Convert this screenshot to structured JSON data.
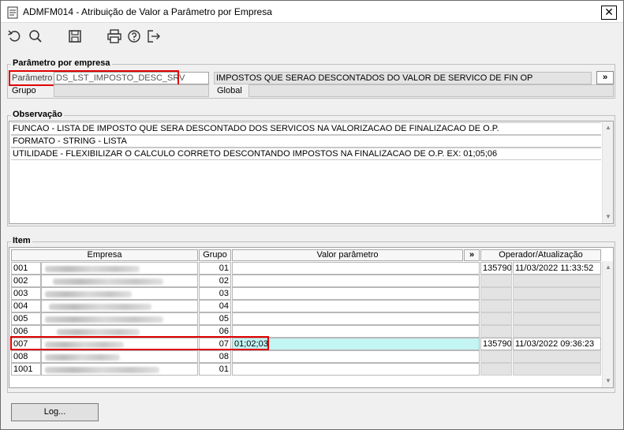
{
  "window": {
    "title": "ADMFM014 - Atribuição de Valor a Parâmetro por Empresa",
    "close_label": "✕"
  },
  "toolbar": {
    "icons": [
      "undo-icon",
      "search-icon",
      "save-icon",
      "print-icon",
      "help-icon",
      "exit-icon"
    ]
  },
  "parametro_empresa": {
    "legend": "Parâmetro por empresa",
    "parametro_label": "Parâmetro",
    "parametro_value": "DS_LST_IMPOSTO_DESC_SRV",
    "descricao_value": "IMPOSTOS QUE SERAO DESCONTADOS DO VALOR DE SERVICO DE FIN OP",
    "expand_label": "»",
    "grupo_label": "Grupo",
    "grupo_value": "",
    "global_label": "Global",
    "global_value": ""
  },
  "observacao": {
    "legend": "Observação",
    "lines": [
      "FUNCAO - LISTA DE IMPOSTO QUE SERA DESCONTADO DOS SERVICOS NA VALORIZACAO DE FINALIZACAO DE O.P.",
      "FORMATO - STRING - LISTA",
      "UTILIDADE - FLEXIBILIZAR O CALCULO CORRETO DESCONTANDO IMPOSTOS NA FINALIZACAO DE O.P. EX: 01;05;06"
    ]
  },
  "item": {
    "legend": "Item",
    "columns": {
      "empresa": "Empresa",
      "grupo": "Grupo",
      "valor": "Valor parâmetro",
      "expand": "»",
      "operador": "Operador/Atualização"
    },
    "rows": [
      {
        "code": "001",
        "grupo": "01",
        "valor": "",
        "operador": "135790",
        "data": "11/03/2022 11:33:52"
      },
      {
        "code": "002",
        "grupo": "02",
        "valor": "",
        "operador": "",
        "data": ""
      },
      {
        "code": "003",
        "grupo": "03",
        "valor": "",
        "operador": "",
        "data": ""
      },
      {
        "code": "004",
        "grupo": "04",
        "valor": "",
        "operador": "",
        "data": ""
      },
      {
        "code": "005",
        "grupo": "05",
        "valor": "",
        "operador": "",
        "data": ""
      },
      {
        "code": "006",
        "grupo": "06",
        "valor": "",
        "operador": "",
        "data": ""
      },
      {
        "code": "007",
        "grupo": "07",
        "valor": "01;02;03",
        "operador": "135790",
        "data": "11/03/2022 09:36:23"
      },
      {
        "code": "008",
        "grupo": "08",
        "valor": "",
        "operador": "",
        "data": ""
      },
      {
        "code": "1001",
        "grupo": "01",
        "valor": "",
        "operador": "",
        "data": ""
      }
    ]
  },
  "footer": {
    "log_label": "Log..."
  },
  "colors": {
    "highlight": "#e00000",
    "selected_row": "#c3f5f5",
    "readonly": "#e3e3e3"
  }
}
